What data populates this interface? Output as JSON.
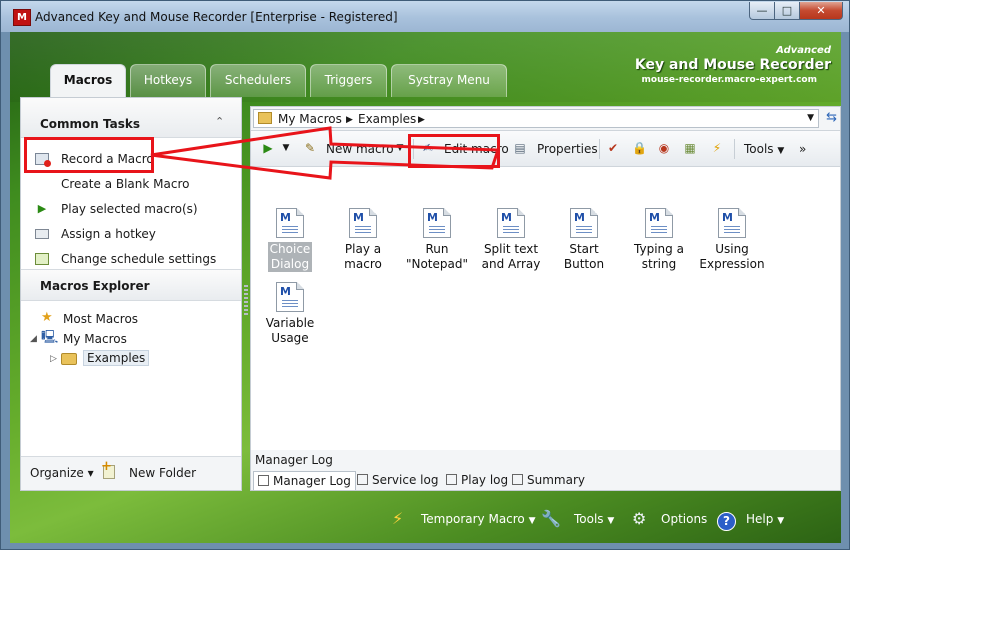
{
  "window": {
    "app_icon_letter": "M",
    "title": "Advanced Key and Mouse Recorder [Enterprise - Registered]",
    "minimize_glyph": "—",
    "maximize_glyph": "□",
    "close_glyph": "✕"
  },
  "brand": {
    "subtitle": "Advanced",
    "name": "Key and Mouse Recorder",
    "url": "mouse-recorder.macro-expert.com"
  },
  "tabs": [
    "Macros",
    "Hotkeys",
    "Schedulers",
    "Triggers",
    "Systray Menu"
  ],
  "common_tasks": {
    "title": "Common Tasks",
    "collapse_glyph": "⌃",
    "items": [
      {
        "label": "Record a Macro",
        "icon": "record-icon"
      },
      {
        "label": "Create a Blank Macro",
        "icon": "none"
      },
      {
        "label": "Play selected macro(s)",
        "icon": "play-icon"
      },
      {
        "label": "Assign a hotkey",
        "icon": "keyboard-icon"
      },
      {
        "label": "Change schedule settings",
        "icon": "schedule-icon"
      }
    ]
  },
  "macros_explorer": {
    "title": "Macros Explorer",
    "items": [
      {
        "label": "Most Macros",
        "icon": "star-icon"
      },
      {
        "label": "My Macros",
        "icon": "computer-icon"
      },
      {
        "label": "Examples",
        "icon": "folder-icon"
      }
    ]
  },
  "left_footer": {
    "organize": "Organize",
    "new_folder": "New Folder"
  },
  "address": {
    "crumbs": [
      "My Macros",
      "Examples"
    ]
  },
  "toolbar": {
    "new_macro": "New macro",
    "edit_macro": "Edit macro",
    "properties": "Properties",
    "tools": "Tools",
    "more": "»"
  },
  "files": [
    {
      "label": "Choice\nDialog",
      "selected": true
    },
    {
      "label": "Play a\nmacro",
      "selected": false
    },
    {
      "label": "Run\n\"Notepad\"",
      "selected": false
    },
    {
      "label": "Split text\nand Array",
      "selected": false
    },
    {
      "label": "Start Button",
      "selected": false
    },
    {
      "label": "Typing a\nstring",
      "selected": false
    },
    {
      "label": "Using\nExpression",
      "selected": false
    },
    {
      "label": "Variable\nUsage",
      "selected": false
    }
  ],
  "file_icon_letter": "M",
  "log": {
    "title": "Manager Log",
    "tabs": [
      "Manager Log",
      "Service log",
      "Play log",
      "Summary"
    ]
  },
  "bottom_bar": {
    "temporary_macro": "Temporary Macro",
    "tools": "Tools",
    "options": "Options",
    "help": "Help"
  },
  "colors": {
    "annotation": "#e8141a",
    "accent_green": "#5ea52a"
  }
}
